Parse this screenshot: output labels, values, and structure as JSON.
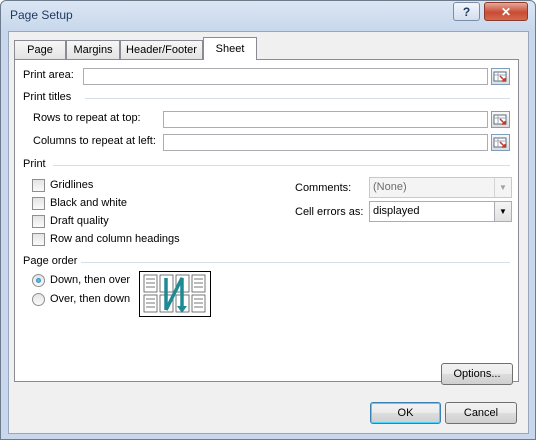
{
  "window": {
    "title": "Page Setup",
    "help_label": "?",
    "close_label": "✕"
  },
  "tabs": [
    {
      "label": "Page",
      "active": false
    },
    {
      "label": "Margins",
      "active": false
    },
    {
      "label": "Header/Footer",
      "active": false
    },
    {
      "label": "Sheet",
      "active": true
    }
  ],
  "print_area": {
    "label": "Print area:",
    "value": ""
  },
  "print_titles": {
    "header": "Print titles",
    "rows_label": "Rows to repeat at top:",
    "rows_value": "",
    "columns_label": "Columns to repeat at left:",
    "columns_value": ""
  },
  "print": {
    "header": "Print",
    "checkboxes": [
      {
        "label": "Gridlines",
        "checked": false
      },
      {
        "label": "Black and white",
        "checked": false
      },
      {
        "label": "Draft quality",
        "checked": false
      },
      {
        "label": "Row and column headings",
        "checked": false
      }
    ],
    "comments_label": "Comments:",
    "comments_value": "(None)",
    "cell_errors_label": "Cell errors as:",
    "cell_errors_value": "displayed"
  },
  "page_order": {
    "header": "Page order",
    "options": [
      {
        "label": "Down, then over",
        "selected": true
      },
      {
        "label": "Over, then down",
        "selected": false
      }
    ]
  },
  "buttons": {
    "options": "Options...",
    "ok": "OK",
    "cancel": "Cancel"
  },
  "colors": {
    "accent": "#1a6ea5",
    "order_arrow": "#1f8a93"
  }
}
